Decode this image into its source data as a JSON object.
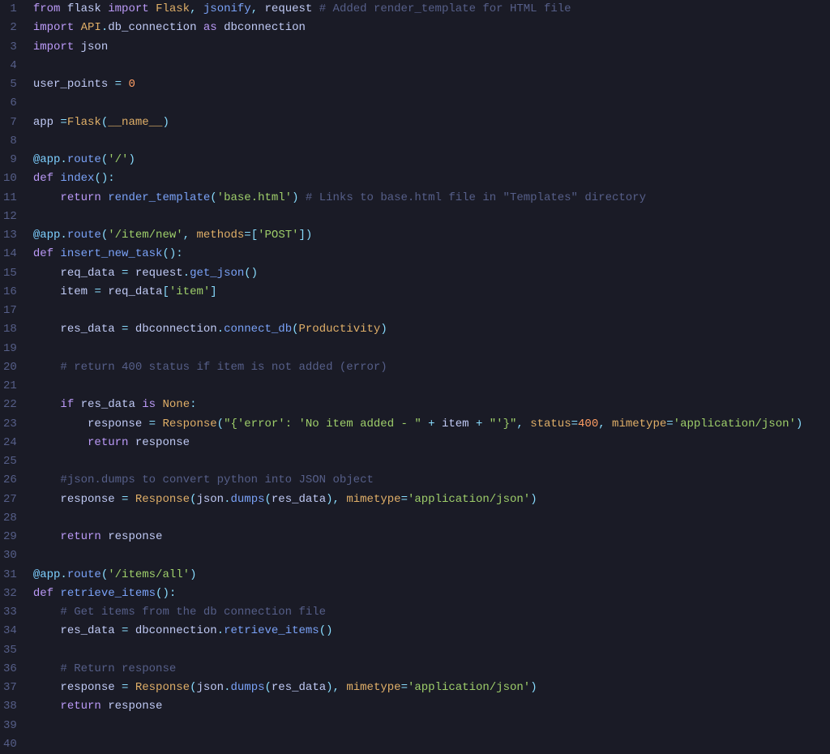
{
  "lineCount": 40,
  "lines": [
    [
      {
        "t": "from ",
        "c": "tok-kw"
      },
      {
        "t": "flask ",
        "c": "tok-ident"
      },
      {
        "t": "import ",
        "c": "tok-kw"
      },
      {
        "t": "Flask",
        "c": "tok-class"
      },
      {
        "t": ", ",
        "c": "tok-op"
      },
      {
        "t": "jsonify",
        "c": "tok-func"
      },
      {
        "t": ", ",
        "c": "tok-op"
      },
      {
        "t": "request ",
        "c": "tok-ident"
      },
      {
        "t": "# Added render_template for HTML file",
        "c": "tok-cmt"
      }
    ],
    [
      {
        "t": "import ",
        "c": "tok-kw"
      },
      {
        "t": "API",
        "c": "tok-class"
      },
      {
        "t": ".",
        "c": "tok-op"
      },
      {
        "t": "db_connection ",
        "c": "tok-ident"
      },
      {
        "t": "as ",
        "c": "tok-kw"
      },
      {
        "t": "dbconnection",
        "c": "tok-ident"
      }
    ],
    [
      {
        "t": "import ",
        "c": "tok-kw"
      },
      {
        "t": "json",
        "c": "tok-ident"
      }
    ],
    [],
    [
      {
        "t": "user_points ",
        "c": "tok-ident"
      },
      {
        "t": "= ",
        "c": "tok-op"
      },
      {
        "t": "0",
        "c": "tok-num"
      }
    ],
    [],
    [
      {
        "t": "app ",
        "c": "tok-ident"
      },
      {
        "t": "=",
        "c": "tok-op"
      },
      {
        "t": "Flask",
        "c": "tok-class"
      },
      {
        "t": "(",
        "c": "tok-op"
      },
      {
        "t": "__name__",
        "c": "tok-special"
      },
      {
        "t": ")",
        "c": "tok-op"
      }
    ],
    [],
    [
      {
        "t": "@app",
        "c": "tok-dec"
      },
      {
        "t": ".",
        "c": "tok-op"
      },
      {
        "t": "route",
        "c": "tok-func"
      },
      {
        "t": "(",
        "c": "tok-op"
      },
      {
        "t": "'/'",
        "c": "tok-str"
      },
      {
        "t": ")",
        "c": "tok-op"
      }
    ],
    [
      {
        "t": "def ",
        "c": "tok-kw"
      },
      {
        "t": "index",
        "c": "tok-def"
      },
      {
        "t": "():",
        "c": "tok-op"
      }
    ],
    [
      {
        "t": "    ",
        "c": ""
      },
      {
        "t": "return ",
        "c": "tok-kw"
      },
      {
        "t": "render_template",
        "c": "tok-func"
      },
      {
        "t": "(",
        "c": "tok-op"
      },
      {
        "t": "'base.html'",
        "c": "tok-str"
      },
      {
        "t": ") ",
        "c": "tok-op"
      },
      {
        "t": "# Links to base.html file in \"Templates\" directory",
        "c": "tok-cmt"
      }
    ],
    [],
    [
      {
        "t": "@app",
        "c": "tok-dec"
      },
      {
        "t": ".",
        "c": "tok-op"
      },
      {
        "t": "route",
        "c": "tok-func"
      },
      {
        "t": "(",
        "c": "tok-op"
      },
      {
        "t": "'/item/new'",
        "c": "tok-str"
      },
      {
        "t": ", ",
        "c": "tok-op"
      },
      {
        "t": "methods",
        "c": "tok-param"
      },
      {
        "t": "=[",
        "c": "tok-op"
      },
      {
        "t": "'POST'",
        "c": "tok-str"
      },
      {
        "t": "])",
        "c": "tok-op"
      }
    ],
    [
      {
        "t": "def ",
        "c": "tok-kw"
      },
      {
        "t": "insert_new_task",
        "c": "tok-def"
      },
      {
        "t": "():",
        "c": "tok-op"
      }
    ],
    [
      {
        "t": "    req_data ",
        "c": "tok-ident"
      },
      {
        "t": "= ",
        "c": "tok-op"
      },
      {
        "t": "request",
        "c": "tok-ident"
      },
      {
        "t": ".",
        "c": "tok-op"
      },
      {
        "t": "get_json",
        "c": "tok-func"
      },
      {
        "t": "()",
        "c": "tok-op"
      }
    ],
    [
      {
        "t": "    item ",
        "c": "tok-ident"
      },
      {
        "t": "= ",
        "c": "tok-op"
      },
      {
        "t": "req_data",
        "c": "tok-ident"
      },
      {
        "t": "[",
        "c": "tok-op"
      },
      {
        "t": "'item'",
        "c": "tok-str"
      },
      {
        "t": "]",
        "c": "tok-op"
      }
    ],
    [],
    [
      {
        "t": "    res_data ",
        "c": "tok-ident"
      },
      {
        "t": "= ",
        "c": "tok-op"
      },
      {
        "t": "dbconnection",
        "c": "tok-ident"
      },
      {
        "t": ".",
        "c": "tok-op"
      },
      {
        "t": "connect_db",
        "c": "tok-func"
      },
      {
        "t": "(",
        "c": "tok-op"
      },
      {
        "t": "Productivity",
        "c": "tok-class"
      },
      {
        "t": ")",
        "c": "tok-op"
      }
    ],
    [],
    [
      {
        "t": "    ",
        "c": ""
      },
      {
        "t": "# return 400 status if item is not added (error)",
        "c": "tok-cmt"
      }
    ],
    [],
    [
      {
        "t": "    ",
        "c": ""
      },
      {
        "t": "if ",
        "c": "tok-kw"
      },
      {
        "t": "res_data ",
        "c": "tok-ident"
      },
      {
        "t": "is ",
        "c": "tok-kw"
      },
      {
        "t": "None",
        "c": "tok-class"
      },
      {
        "t": ":",
        "c": "tok-op"
      }
    ],
    [
      {
        "t": "        response ",
        "c": "tok-ident"
      },
      {
        "t": "= ",
        "c": "tok-op"
      },
      {
        "t": "Response",
        "c": "tok-class"
      },
      {
        "t": "(",
        "c": "tok-op"
      },
      {
        "t": "\"{'error': 'No item added - \"",
        "c": "tok-str"
      },
      {
        "t": " + ",
        "c": "tok-op"
      },
      {
        "t": "item ",
        "c": "tok-ident"
      },
      {
        "t": "+ ",
        "c": "tok-op"
      },
      {
        "t": "\"'}\"",
        "c": "tok-str"
      },
      {
        "t": ", ",
        "c": "tok-op"
      },
      {
        "t": "status",
        "c": "tok-param"
      },
      {
        "t": "=",
        "c": "tok-op"
      },
      {
        "t": "400",
        "c": "tok-num"
      },
      {
        "t": ", ",
        "c": "tok-op"
      },
      {
        "t": "mimetype",
        "c": "tok-param"
      },
      {
        "t": "=",
        "c": "tok-op"
      },
      {
        "t": "'application/json'",
        "c": "tok-str"
      },
      {
        "t": ")",
        "c": "tok-op"
      }
    ],
    [
      {
        "t": "        ",
        "c": ""
      },
      {
        "t": "return ",
        "c": "tok-kw"
      },
      {
        "t": "response",
        "c": "tok-ident"
      }
    ],
    [],
    [
      {
        "t": "    ",
        "c": ""
      },
      {
        "t": "#json.dumps to convert python into JSON object",
        "c": "tok-cmt"
      }
    ],
    [
      {
        "t": "    response ",
        "c": "tok-ident"
      },
      {
        "t": "= ",
        "c": "tok-op"
      },
      {
        "t": "Response",
        "c": "tok-class"
      },
      {
        "t": "(",
        "c": "tok-op"
      },
      {
        "t": "json",
        "c": "tok-ident"
      },
      {
        "t": ".",
        "c": "tok-op"
      },
      {
        "t": "dumps",
        "c": "tok-func"
      },
      {
        "t": "(",
        "c": "tok-op"
      },
      {
        "t": "res_data",
        "c": "tok-ident"
      },
      {
        "t": "), ",
        "c": "tok-op"
      },
      {
        "t": "mimetype",
        "c": "tok-param"
      },
      {
        "t": "=",
        "c": "tok-op"
      },
      {
        "t": "'application/json'",
        "c": "tok-str"
      },
      {
        "t": ")",
        "c": "tok-op"
      }
    ],
    [],
    [
      {
        "t": "    ",
        "c": ""
      },
      {
        "t": "return ",
        "c": "tok-kw"
      },
      {
        "t": "response",
        "c": "tok-ident"
      }
    ],
    [],
    [
      {
        "t": "@app",
        "c": "tok-dec"
      },
      {
        "t": ".",
        "c": "tok-op"
      },
      {
        "t": "route",
        "c": "tok-func"
      },
      {
        "t": "(",
        "c": "tok-op"
      },
      {
        "t": "'/items/all'",
        "c": "tok-str"
      },
      {
        "t": ")",
        "c": "tok-op"
      }
    ],
    [
      {
        "t": "def ",
        "c": "tok-kw"
      },
      {
        "t": "retrieve_items",
        "c": "tok-def"
      },
      {
        "t": "():",
        "c": "tok-op"
      }
    ],
    [
      {
        "t": "    ",
        "c": ""
      },
      {
        "t": "# Get items from the db connection file",
        "c": "tok-cmt"
      }
    ],
    [
      {
        "t": "    res_data ",
        "c": "tok-ident"
      },
      {
        "t": "= ",
        "c": "tok-op"
      },
      {
        "t": "dbconnection",
        "c": "tok-ident"
      },
      {
        "t": ".",
        "c": "tok-op"
      },
      {
        "t": "retrieve_items",
        "c": "tok-func"
      },
      {
        "t": "()",
        "c": "tok-op"
      }
    ],
    [],
    [
      {
        "t": "    ",
        "c": ""
      },
      {
        "t": "# Return response",
        "c": "tok-cmt"
      }
    ],
    [
      {
        "t": "    response ",
        "c": "tok-ident"
      },
      {
        "t": "= ",
        "c": "tok-op"
      },
      {
        "t": "Response",
        "c": "tok-class"
      },
      {
        "t": "(",
        "c": "tok-op"
      },
      {
        "t": "json",
        "c": "tok-ident"
      },
      {
        "t": ".",
        "c": "tok-op"
      },
      {
        "t": "dumps",
        "c": "tok-func"
      },
      {
        "t": "(",
        "c": "tok-op"
      },
      {
        "t": "res_data",
        "c": "tok-ident"
      },
      {
        "t": "), ",
        "c": "tok-op"
      },
      {
        "t": "mimetype",
        "c": "tok-param"
      },
      {
        "t": "=",
        "c": "tok-op"
      },
      {
        "t": "'application/json'",
        "c": "tok-str"
      },
      {
        "t": ")",
        "c": "tok-op"
      }
    ],
    [
      {
        "t": "    ",
        "c": ""
      },
      {
        "t": "return ",
        "c": "tok-kw"
      },
      {
        "t": "response",
        "c": "tok-ident"
      }
    ],
    [],
    []
  ]
}
